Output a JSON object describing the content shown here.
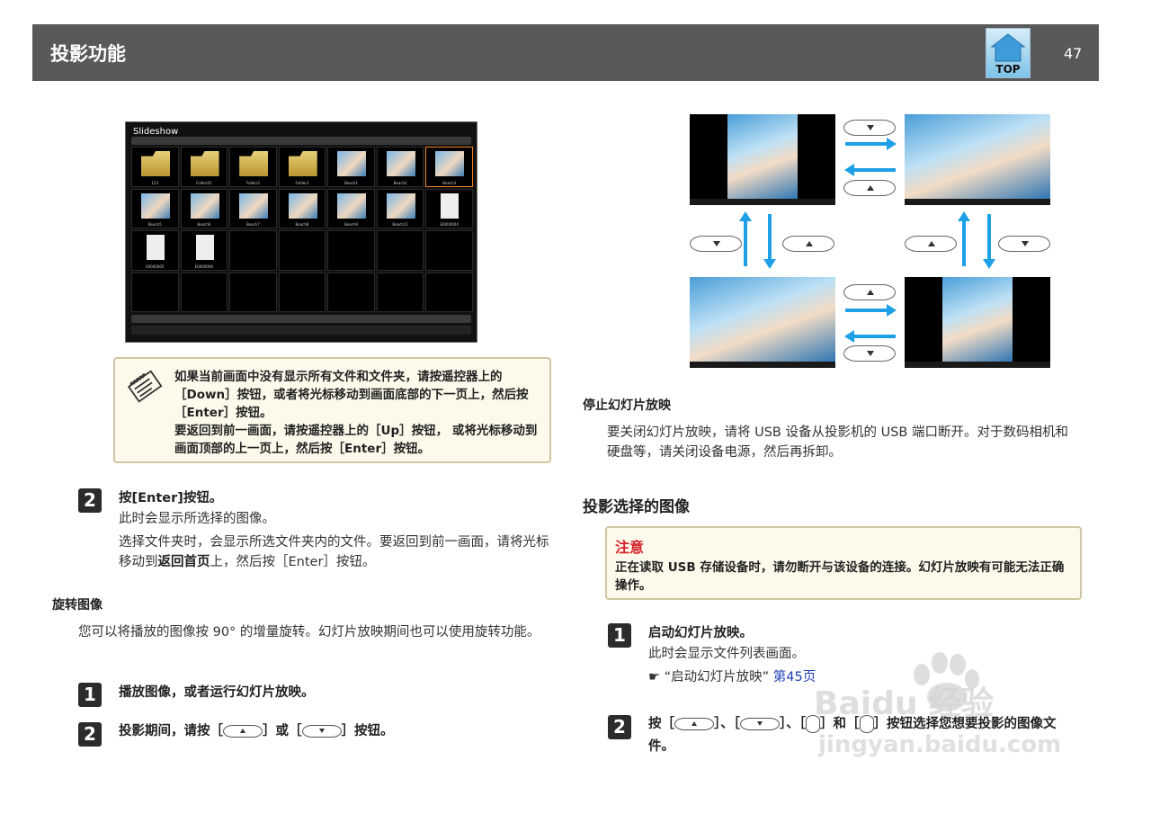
{
  "header": {
    "title": "投影功能",
    "top_label": "TOP",
    "page_number": "47"
  },
  "slideshow": {
    "title": "Slideshow",
    "items": [
      {
        "kind": "folder",
        "caption": "123"
      },
      {
        "kind": "folder",
        "caption": "Folder01"
      },
      {
        "kind": "folder",
        "caption": "Folder2"
      },
      {
        "kind": "folder",
        "caption": "Folder3"
      },
      {
        "kind": "photo",
        "caption": "Beach1"
      },
      {
        "kind": "photo",
        "caption": "Beach2"
      },
      {
        "kind": "photo",
        "caption": "Beach3",
        "selected": true
      },
      {
        "kind": "photo",
        "caption": "Beach5"
      },
      {
        "kind": "photo",
        "caption": "Beach6"
      },
      {
        "kind": "photo",
        "caption": "Beach7"
      },
      {
        "kind": "photo",
        "caption": "Beach8"
      },
      {
        "kind": "photo",
        "caption": "Beach9"
      },
      {
        "kind": "photo",
        "caption": "Beach11"
      },
      {
        "kind": "file",
        "caption": "E0000004"
      },
      {
        "kind": "file",
        "caption": "E0000005"
      },
      {
        "kind": "file",
        "caption": "E0000006"
      }
    ]
  },
  "note": {
    "p1": "如果当前画面中没有显示所有文件和文件夹，请按遥控器上的［Down］按钮，或者将光标移动到画面底部的下一页上，然后按［Enter］按钮。",
    "p2": "要返回到前一画面，请按遥控器上的［Up］按钮， 或将光标移动到画面顶部的上一页上，然后按［Enter］按钮。"
  },
  "left": {
    "step2_num": "2",
    "step2_title": "按[Enter]按钮。",
    "step2_body1": "此时会显示所选择的图像。",
    "step2_body2a": "选择文件夹时，会显示所选文件夹内的文件。要返回到前一画面，请将光标移动到",
    "step2_body2b": "返回首页",
    "step2_body2c": "上，然后按［Enter］按钮。",
    "rotate_heading": "旋转图像",
    "rotate_body": "您可以将播放的图像按 90° 的增量旋转。幻灯片放映期间也可以使用旋转功能。",
    "r1_num": "1",
    "r1_title": "播放图像，或者运行幻灯片放映。",
    "r2_num": "2",
    "r2_a": "投影期间，请按［",
    "r2_b": "］或［",
    "r2_c": "］按钮。"
  },
  "right": {
    "stop_heading": "停止幻灯片放映",
    "stop_body": "要关闭幻灯片放映，请将 USB 设备从投影机的 USB 端口断开。对于数码相机和硬盘等，请关闭设备电源，然后再拆卸。",
    "project_heading": "投影选择的图像",
    "caution_title": "注意",
    "caution_text": "正在读取 USB 存储设备时，请勿断开与该设备的连接。幻灯片放映有可能无法正确操作。",
    "s1_num": "1",
    "s1_title": "启动幻灯片放映。",
    "s1_body": "此时会显示文件列表画面。",
    "s1_ref_symbol": "☛",
    "s1_ref_text": "“启动幻灯片放映”",
    "s1_ref_link": "第45页",
    "s2_num": "2",
    "s2_a": "按［",
    "s2_b": "］、［",
    "s2_c": "］、［",
    "s2_d": "］和［",
    "s2_e": "］按钮选择您想要投影的图像文件。"
  },
  "watermark": {
    "brand": "Baidu 经验",
    "url": "jingyan.baidu.com"
  }
}
